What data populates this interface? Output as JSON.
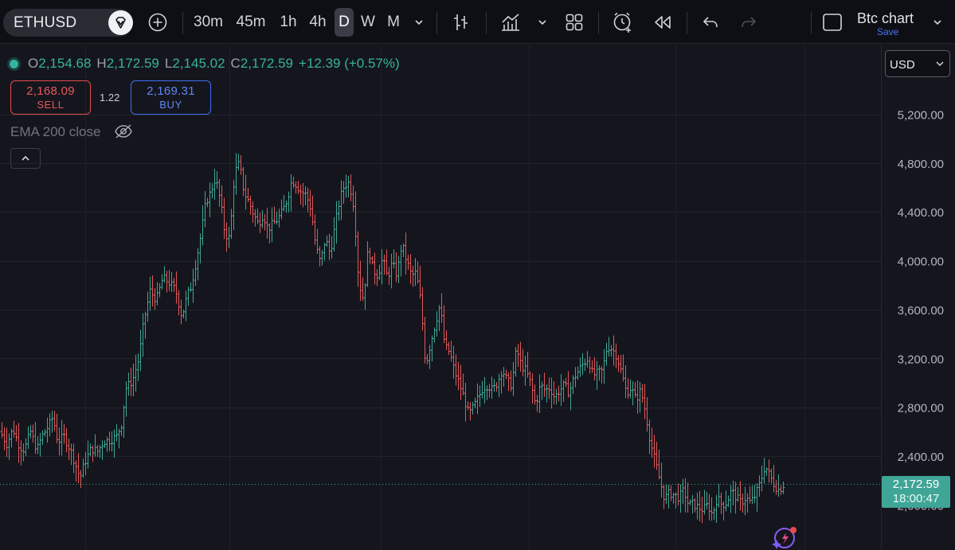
{
  "toolbar": {
    "symbol": "ETHUSD",
    "timeframes": [
      {
        "label": "30m",
        "active": false
      },
      {
        "label": "45m",
        "active": false
      },
      {
        "label": "1h",
        "active": false
      },
      {
        "label": "4h",
        "active": false
      },
      {
        "label": "D",
        "active": true
      },
      {
        "label": "W",
        "active": false
      },
      {
        "label": "M",
        "active": false
      }
    ],
    "layout_name": "Btc chart",
    "layout_save_label": "Save",
    "icons": [
      "add-symbol-icon",
      "timeframe-dropdown-icon",
      "bar-style-icon",
      "indicators-icon",
      "indicators-dropdown-icon",
      "templates-icon",
      "alert-icon",
      "replay-icon",
      "undo-icon",
      "redo-icon",
      "layout-box-icon",
      "layout-dropdown-icon"
    ]
  },
  "legend": {
    "open_label": "O",
    "open": "2,154.68",
    "high_label": "H",
    "high": "2,172.59",
    "low_label": "L",
    "low": "2,145.02",
    "close_label": "C",
    "close": "2,172.59",
    "change": "+12.39 (+0.57%)"
  },
  "trade": {
    "sell_price": "2,168.09",
    "sell_label": "SELL",
    "spread": "1.22",
    "buy_price": "2,169.31",
    "buy_label": "BUY"
  },
  "indicator": {
    "label": "EMA 200 close",
    "visibility": "hidden"
  },
  "currency": "USD",
  "last_price": {
    "price": "2,172.59",
    "countdown": "18:00:47"
  },
  "colors": {
    "up": "#3fa596",
    "down": "#e0575a",
    "background": "#15161d",
    "accent": "#4a74f0"
  },
  "chart_data": {
    "type": "ohlc",
    "symbol": "ETHUSD",
    "interval": "D",
    "y_axis_ticks": [
      "5,200.00",
      "4,800.00",
      "4,400.00",
      "4,000.00",
      "3,600.00",
      "3,200.00",
      "2,800.00",
      "2,400.00"
    ],
    "ylim": [
      1790,
      5550
    ],
    "last_price_line": 2172.59,
    "grid": true,
    "close_path": [
      [
        0,
        2600
      ],
      [
        8,
        2500
      ],
      [
        16,
        2620
      ],
      [
        24,
        2480
      ],
      [
        30,
        2450
      ],
      [
        38,
        2600
      ],
      [
        46,
        2450
      ],
      [
        52,
        2560
      ],
      [
        60,
        2640
      ],
      [
        66,
        2720
      ],
      [
        72,
        2520
      ],
      [
        80,
        2560
      ],
      [
        88,
        2450
      ],
      [
        96,
        2300
      ],
      [
        100,
        2220
      ],
      [
        106,
        2350
      ],
      [
        114,
        2460
      ],
      [
        122,
        2440
      ],
      [
        130,
        2520
      ],
      [
        138,
        2530
      ],
      [
        146,
        2560
      ],
      [
        152,
        2660
      ],
      [
        158,
        2960
      ],
      [
        166,
        3020
      ],
      [
        174,
        3200
      ],
      [
        180,
        3500
      ],
      [
        188,
        3750
      ],
      [
        196,
        3680
      ],
      [
        204,
        3860
      ],
      [
        212,
        3820
      ],
      [
        220,
        3760
      ],
      [
        228,
        3540
      ],
      [
        234,
        3700
      ],
      [
        240,
        3800
      ],
      [
        246,
        4000
      ],
      [
        252,
        4220
      ],
      [
        258,
        4480
      ],
      [
        264,
        4560
      ],
      [
        270,
        4680
      ],
      [
        276,
        4500
      ],
      [
        282,
        4220
      ],
      [
        288,
        4180
      ],
      [
        294,
        4720
      ],
      [
        300,
        4800
      ],
      [
        306,
        4560
      ],
      [
        312,
        4480
      ],
      [
        318,
        4380
      ],
      [
        324,
        4300
      ],
      [
        330,
        4380
      ],
      [
        336,
        4260
      ],
      [
        342,
        4300
      ],
      [
        348,
        4340
      ],
      [
        354,
        4400
      ],
      [
        360,
        4500
      ],
      [
        366,
        4660
      ],
      [
        372,
        4620
      ],
      [
        378,
        4560
      ],
      [
        384,
        4540
      ],
      [
        390,
        4420
      ],
      [
        396,
        4120
      ],
      [
        402,
        3980
      ],
      [
        408,
        4180
      ],
      [
        414,
        4060
      ],
      [
        420,
        4280
      ],
      [
        426,
        4500
      ],
      [
        432,
        4620
      ],
      [
        438,
        4640
      ],
      [
        444,
        4440
      ],
      [
        450,
        3820
      ],
      [
        456,
        3680
      ],
      [
        462,
        4120
      ],
      [
        468,
        3920
      ],
      [
        474,
        3880
      ],
      [
        480,
        4020
      ],
      [
        486,
        3860
      ],
      [
        492,
        3980
      ],
      [
        498,
        3880
      ],
      [
        504,
        4140
      ],
      [
        510,
        4000
      ],
      [
        516,
        3880
      ],
      [
        522,
        3900
      ],
      [
        528,
        3660
      ],
      [
        534,
        3140
      ],
      [
        540,
        3320
      ],
      [
        546,
        3480
      ],
      [
        552,
        3640
      ],
      [
        558,
        3300
      ],
      [
        564,
        3250
      ],
      [
        570,
        3100
      ],
      [
        576,
        3000
      ],
      [
        582,
        2880
      ],
      [
        588,
        2740
      ],
      [
        594,
        2800
      ],
      [
        600,
        2880
      ],
      [
        606,
        2960
      ],
      [
        612,
        2980
      ],
      [
        618,
        2940
      ],
      [
        624,
        3000
      ],
      [
        630,
        3110
      ],
      [
        636,
        3020
      ],
      [
        642,
        2980
      ],
      [
        648,
        3280
      ],
      [
        654,
        3140
      ],
      [
        660,
        3100
      ],
      [
        666,
        2990
      ],
      [
        672,
        2820
      ],
      [
        678,
        2980
      ],
      [
        684,
        2940
      ],
      [
        690,
        2960
      ],
      [
        696,
        2880
      ],
      [
        702,
        2940
      ],
      [
        708,
        2980
      ],
      [
        714,
        2920
      ],
      [
        720,
        3040
      ],
      [
        726,
        3100
      ],
      [
        732,
        3160
      ],
      [
        738,
        3200
      ],
      [
        744,
        3060
      ],
      [
        750,
        3080
      ],
      [
        756,
        3100
      ],
      [
        762,
        3300
      ],
      [
        768,
        3280
      ],
      [
        774,
        3220
      ],
      [
        780,
        3080
      ],
      [
        786,
        2920
      ],
      [
        792,
        2960
      ],
      [
        798,
        2860
      ],
      [
        804,
        2940
      ],
      [
        810,
        2760
      ],
      [
        816,
        2520
      ],
      [
        822,
        2360
      ],
      [
        828,
        2200
      ],
      [
        834,
        2050
      ],
      [
        840,
        2100
      ],
      [
        846,
        2080
      ],
      [
        852,
        2060
      ],
      [
        858,
        2120
      ],
      [
        864,
        2000
      ],
      [
        870,
        2010
      ],
      [
        876,
        1980
      ],
      [
        882,
        1960
      ],
      [
        888,
        2000
      ],
      [
        894,
        1920
      ],
      [
        900,
        2060
      ],
      [
        906,
        2000
      ],
      [
        912,
        2020
      ],
      [
        918,
        2120
      ],
      [
        924,
        2060
      ],
      [
        930,
        2020
      ],
      [
        936,
        2060
      ],
      [
        942,
        2020
      ],
      [
        948,
        2080
      ],
      [
        954,
        2180
      ],
      [
        960,
        2320
      ],
      [
        966,
        2240
      ],
      [
        972,
        2160
      ],
      [
        978,
        2120
      ],
      [
        984,
        2172.59
      ]
    ]
  }
}
